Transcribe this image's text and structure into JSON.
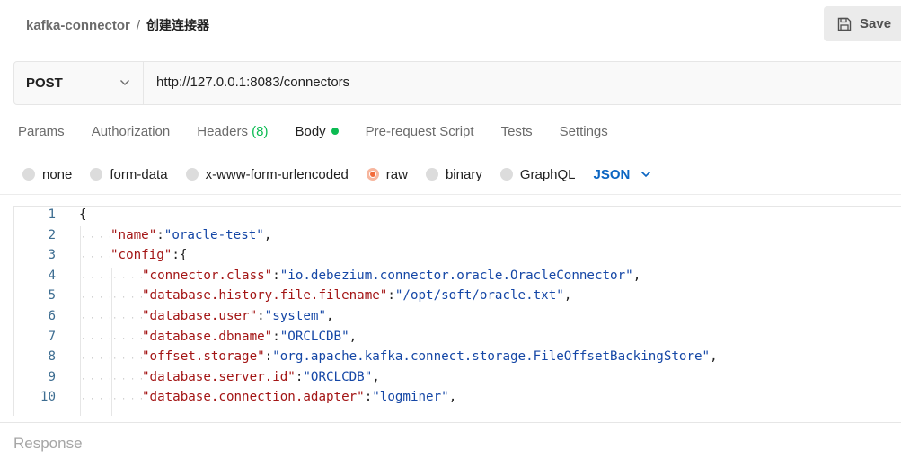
{
  "breadcrumb": {
    "parent": "kafka-connector",
    "separator": "/",
    "current": "创建连接器"
  },
  "save_button": {
    "label": "Save",
    "icon": "save-icon"
  },
  "request": {
    "method": "POST",
    "url": "http://127.0.0.1:8083/connectors"
  },
  "tabs": [
    {
      "label": "Params"
    },
    {
      "label": "Authorization"
    },
    {
      "label": "Headers",
      "count": "(8)"
    },
    {
      "label": "Body",
      "active": true,
      "indicator_color": "#0cbb52"
    },
    {
      "label": "Pre-request Script"
    },
    {
      "label": "Tests"
    },
    {
      "label": "Settings"
    }
  ],
  "body_types": [
    {
      "label": "none"
    },
    {
      "label": "form-data"
    },
    {
      "label": "x-www-form-urlencoded"
    },
    {
      "label": "raw",
      "selected": true
    },
    {
      "label": "binary"
    },
    {
      "label": "GraphQL"
    }
  ],
  "body_language": "JSON",
  "editor": {
    "lines": [
      {
        "num": "1",
        "indent": 0,
        "parts": [
          [
            "p",
            "{"
          ]
        ]
      },
      {
        "num": "2",
        "indent": 1,
        "parts": [
          [
            "k",
            "\"name\""
          ],
          [
            "p",
            ":"
          ],
          [
            "s",
            "\"oracle-test\""
          ],
          [
            "p",
            ","
          ]
        ]
      },
      {
        "num": "3",
        "indent": 1,
        "parts": [
          [
            "k",
            "\"config\""
          ],
          [
            "p",
            ":{"
          ]
        ]
      },
      {
        "num": "4",
        "indent": 2,
        "parts": [
          [
            "k",
            "\"connector.class\""
          ],
          [
            "p",
            ":"
          ],
          [
            "s",
            "\"io.debezium.connector.oracle.OracleConnector\""
          ],
          [
            "p",
            ","
          ]
        ]
      },
      {
        "num": "5",
        "indent": 2,
        "parts": [
          [
            "k",
            "\"database.history.file.filename\""
          ],
          [
            "p",
            ":"
          ],
          [
            "s",
            "\"/opt/soft/oracle.txt\""
          ],
          [
            "p",
            ","
          ]
        ]
      },
      {
        "num": "6",
        "indent": 2,
        "parts": [
          [
            "k",
            "\"database.user\""
          ],
          [
            "p",
            ":"
          ],
          [
            "s",
            "\"system\""
          ],
          [
            "p",
            ","
          ]
        ]
      },
      {
        "num": "7",
        "indent": 2,
        "parts": [
          [
            "k",
            "\"database.dbname\""
          ],
          [
            "p",
            ":"
          ],
          [
            "s",
            "\"ORCLCDB\""
          ],
          [
            "p",
            ","
          ]
        ]
      },
      {
        "num": "8",
        "indent": 2,
        "parts": [
          [
            "k",
            "\"offset.storage\""
          ],
          [
            "p",
            ":"
          ],
          [
            "s",
            "\"org.apache.kafka.connect.storage.FileOffsetBackingStore\""
          ],
          [
            "p",
            ","
          ]
        ]
      },
      {
        "num": "9",
        "indent": 2,
        "parts": [
          [
            "k",
            "\"database.server.id\""
          ],
          [
            "p",
            ":"
          ],
          [
            "s",
            "\"ORCLCDB\""
          ],
          [
            "p",
            ","
          ]
        ]
      },
      {
        "num": "10",
        "indent": 2,
        "parts": [
          [
            "k",
            "\"database.connection.adapter\""
          ],
          [
            "p",
            ":"
          ],
          [
            "s",
            "\"logminer\""
          ],
          [
            "p",
            ","
          ]
        ]
      }
    ]
  },
  "response_label": "Response",
  "colors": {
    "key": "#a31515",
    "string": "#1547a6",
    "line_number": "#3d6d91",
    "accent_orange": "#f26b3a",
    "accent_green": "#0cbb52",
    "link_blue": "#0b65c2"
  }
}
